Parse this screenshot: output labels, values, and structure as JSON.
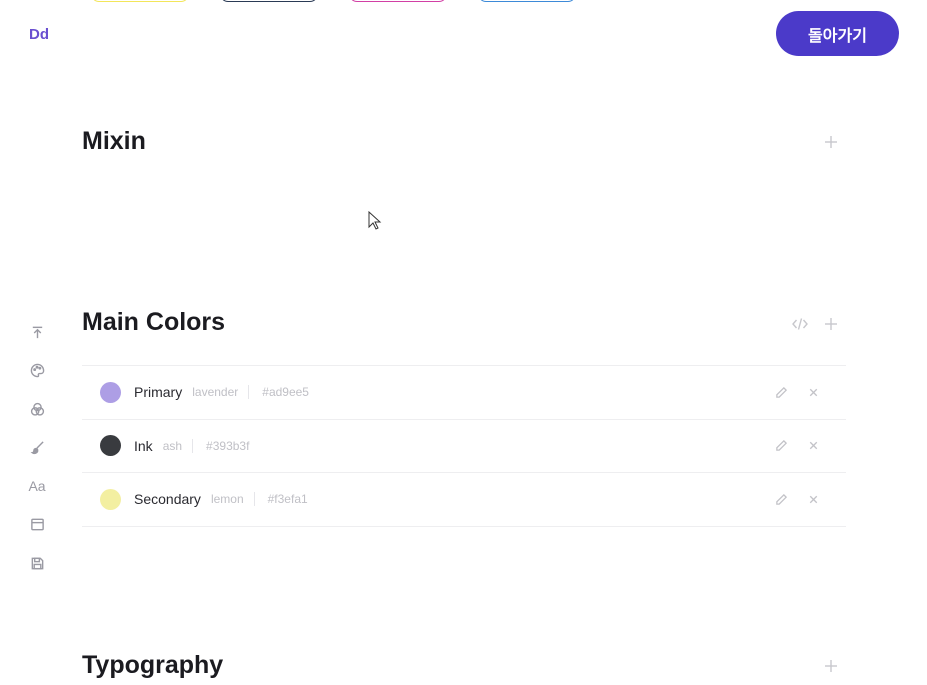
{
  "header": {
    "logo": "Dd",
    "back_button": "돌아가기"
  },
  "top_pills": [
    {
      "color": "#f3e65a"
    },
    {
      "color": "#2a3a55"
    },
    {
      "color": "#d23fa5"
    },
    {
      "color": "#3d8ad8"
    }
  ],
  "sidebar": {
    "items": [
      {
        "icon": "arrow-up-to-top-icon"
      },
      {
        "icon": "palette-icon"
      },
      {
        "icon": "color-circles-icon"
      },
      {
        "icon": "brush-icon"
      },
      {
        "icon": "typography-icon",
        "text": "Aa"
      },
      {
        "icon": "layout-icon"
      },
      {
        "icon": "save-icon"
      }
    ]
  },
  "sections": {
    "mixin": {
      "title": "Mixin"
    },
    "main_colors": {
      "title": "Main Colors"
    },
    "typography": {
      "title": "Typography"
    }
  },
  "colors": [
    {
      "name": "Primary",
      "alias": "lavender",
      "hex": "#ad9ee5",
      "swatch": "#ad9ee5"
    },
    {
      "name": "Ink",
      "alias": "ash",
      "hex": "#393b3f",
      "swatch": "#393b3f"
    },
    {
      "name": "Secondary",
      "alias": "lemon",
      "hex": "#f3efa1",
      "swatch": "#f3efa1"
    }
  ]
}
